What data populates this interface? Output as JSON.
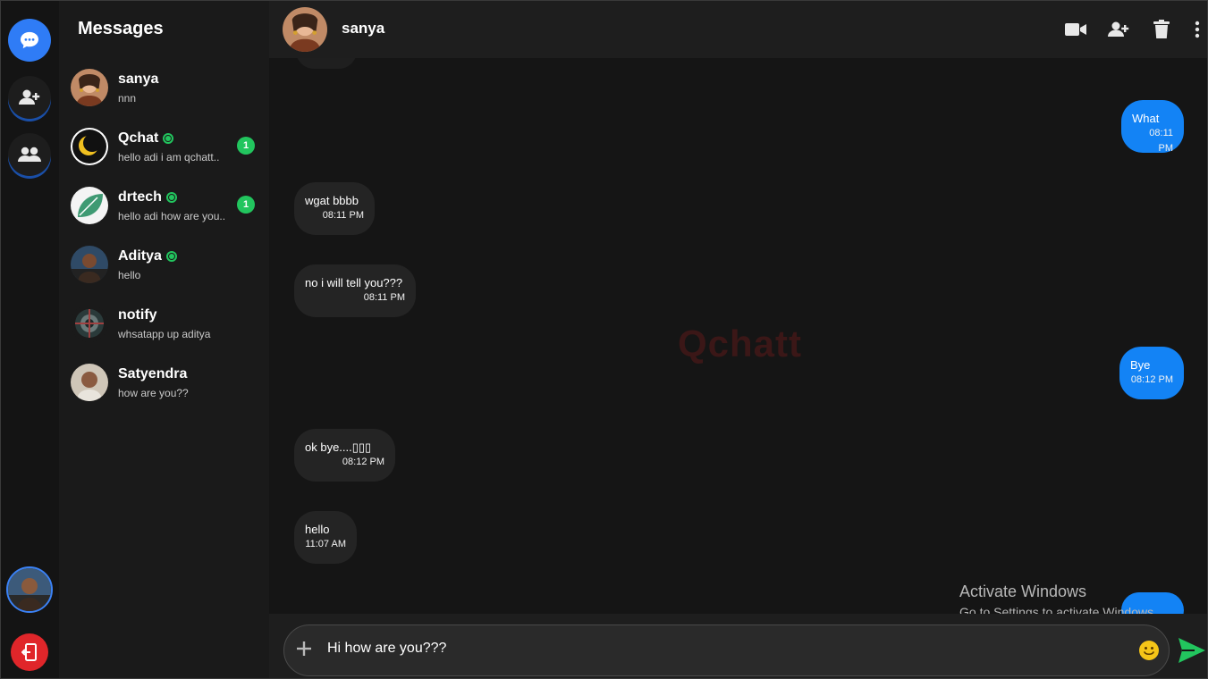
{
  "rail": {
    "items": [
      {
        "name": "messages"
      },
      {
        "name": "add-friend"
      },
      {
        "name": "groups"
      }
    ]
  },
  "sidebar": {
    "title": "Messages",
    "conversations": [
      {
        "name": "sanya",
        "preview": "nnn",
        "online": false,
        "badge": ""
      },
      {
        "name": "Qchat",
        "preview": "hello adi i am qchatt..",
        "online": true,
        "badge": "1"
      },
      {
        "name": "drtech",
        "preview": "hello adi how are you..",
        "online": true,
        "badge": "1"
      },
      {
        "name": "Aditya",
        "preview": "hello",
        "online": true,
        "badge": ""
      },
      {
        "name": "notify",
        "preview": "whsatapp up aditya",
        "online": false,
        "badge": ""
      },
      {
        "name": "Satyendra",
        "preview": "how are you??",
        "online": false,
        "badge": ""
      }
    ]
  },
  "chat": {
    "contact_name": "sanya",
    "watermark": "Qchatt",
    "messages": [
      {
        "text": "What",
        "time": "08:11 PM",
        "direction": "out"
      },
      {
        "text": "wgat bbbb",
        "time": "08:11 PM",
        "direction": "in"
      },
      {
        "text": "no i will tell you???",
        "time": "08:11 PM",
        "direction": "in"
      },
      {
        "text": "Bye",
        "time": "08:12 PM",
        "direction": "out"
      },
      {
        "text": "ok bye....▯▯▯",
        "time": "08:12 PM",
        "direction": "in"
      },
      {
        "text": "hello",
        "time": "11:07 AM",
        "direction": "in"
      }
    ]
  },
  "composer": {
    "value": "Hi how are you???"
  },
  "os_overlay": {
    "line1": "Activate Windows",
    "line2": "Go to Settings to activate Windows."
  },
  "colors": {
    "accent": "#1383f5",
    "online": "#22c55e",
    "logout": "#e0262a",
    "send": "#22c55e"
  }
}
